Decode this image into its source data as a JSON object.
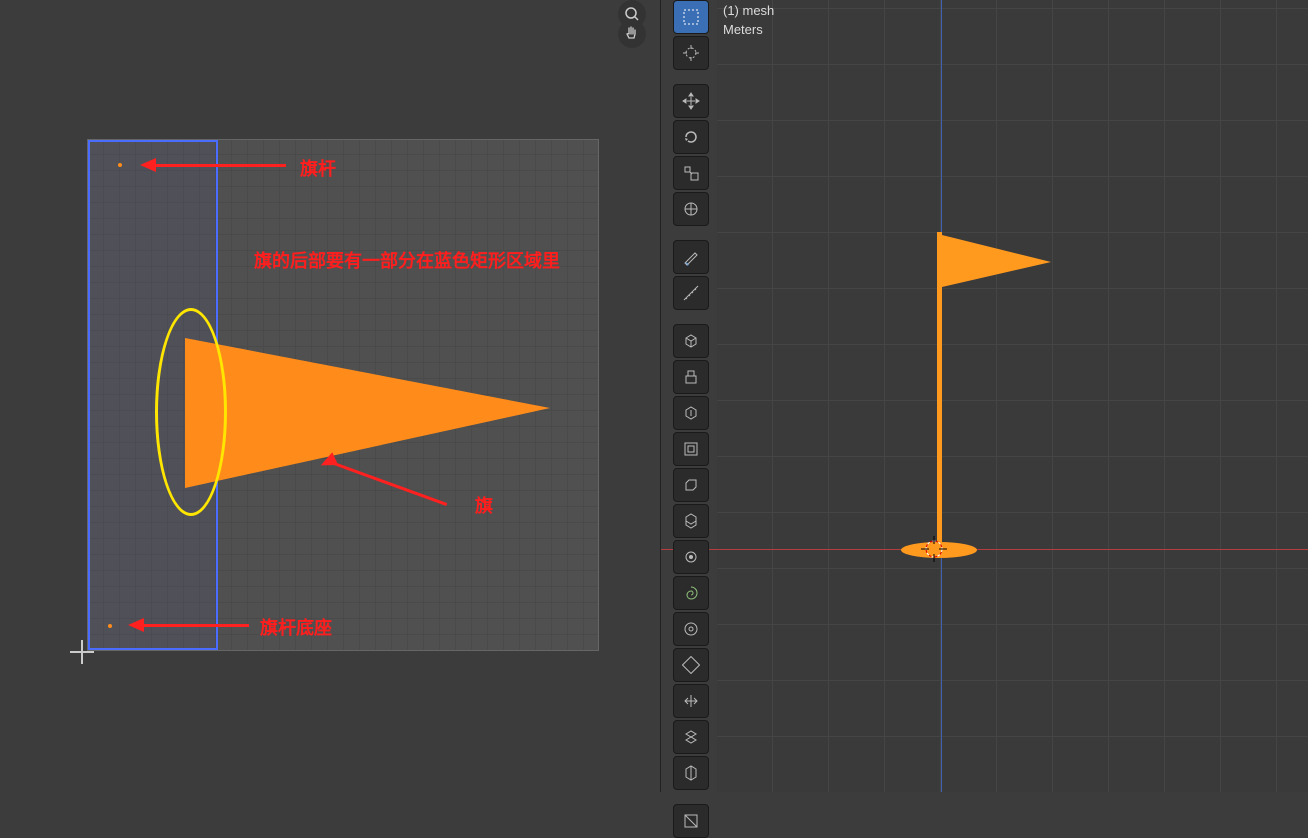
{
  "annotations": {
    "pole_label": "旗杆",
    "flag_overlap_note": "旗的后部要有一部分在蓝色矩形区域里",
    "flag_label": "旗",
    "base_label": "旗杆底座"
  },
  "right_header": {
    "line1": "(1) mesh",
    "line2": "Meters"
  },
  "tools": {
    "select_box": "select-box",
    "cursor": "cursor-tool",
    "move": "move-tool",
    "rotate": "rotate-tool",
    "scale": "scale-tool",
    "transform": "transform-tool",
    "annotate": "annotate-tool",
    "measure": "measure-tool",
    "add_cube": "add-cube",
    "extrude_region": "extrude-region",
    "extrude_manifold": "extrude-manifold",
    "inset": "inset-faces",
    "bevel": "bevel",
    "loop_cut": "loop-cut",
    "knife": "knife",
    "poly_build": "poly-build",
    "spin": "spin",
    "smooth": "smooth",
    "edge_slide": "edge-slide",
    "shrink_fatten": "shrink-fatten",
    "rip": "rip-region"
  },
  "nav": {
    "zoom": "zoom-icon",
    "pan": "pan-icon"
  }
}
